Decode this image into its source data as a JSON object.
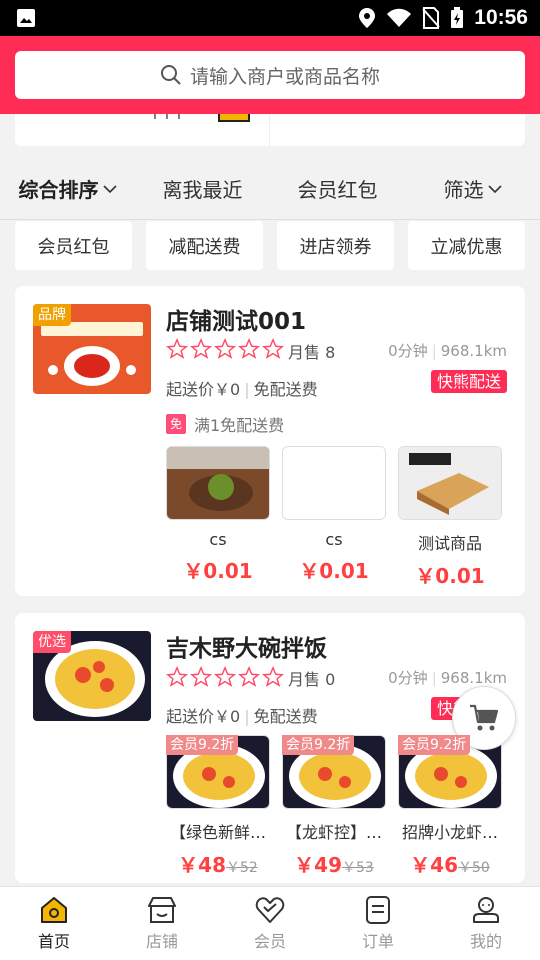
{
  "status_bar": {
    "time": "10:56"
  },
  "search": {
    "placeholder": "请输入商户或商品名称"
  },
  "sort_bar": {
    "items": [
      {
        "label": "综合排序",
        "active": true,
        "has_chevron": true
      },
      {
        "label": "离我最近",
        "active": false,
        "has_chevron": false
      },
      {
        "label": "会员红包",
        "active": false,
        "has_chevron": false
      },
      {
        "label": "筛选",
        "active": false,
        "has_chevron": true
      }
    ]
  },
  "chips": [
    "会员红包",
    "减配送费",
    "进店领券",
    "立减优惠"
  ],
  "shops": [
    {
      "tag": "品牌",
      "name": "店铺测试001",
      "rating_stars": 0,
      "monthly_sales": "月售 8",
      "time": "0分钟",
      "distance": "968.1km",
      "min_price": "起送价￥0",
      "delivery_fee": "免配送费",
      "delivery_badge": "快熊配送",
      "promo_icon": "免",
      "promo_text": "满1免配送费",
      "products": [
        {
          "name": "cs",
          "price": "￥0.01"
        },
        {
          "name": "cs",
          "price": "￥0.01"
        },
        {
          "name": "测试商品",
          "price": "￥0.01"
        }
      ]
    },
    {
      "tag": "优选",
      "name": "吉木野大碗拌饭",
      "rating_stars": 0,
      "monthly_sales": "月售 0",
      "time": "0分钟",
      "distance": "968.1km",
      "min_price": "起送价￥0",
      "delivery_fee": "免配送费",
      "delivery_badge": "快熊配送",
      "products": [
        {
          "vip_tag": "会员9.2折",
          "name": "【绿色新鲜…",
          "price": "￥48",
          "orig_price": "￥52"
        },
        {
          "vip_tag": "会员9.2折",
          "name": "【龙虾控】…",
          "price": "￥49",
          "orig_price": "￥53"
        },
        {
          "vip_tag": "会员9.2折",
          "name": "招牌小龙虾…",
          "price": "￥46",
          "orig_price": "￥50"
        }
      ]
    }
  ],
  "tabbar": [
    {
      "label": "首页",
      "icon": "home-icon",
      "active": true
    },
    {
      "label": "店铺",
      "icon": "store-icon",
      "active": false
    },
    {
      "label": "会员",
      "icon": "member-heart-icon",
      "active": false
    },
    {
      "label": "订单",
      "icon": "order-icon",
      "active": false
    },
    {
      "label": "我的",
      "icon": "profile-icon",
      "active": false
    }
  ],
  "colors": {
    "brand": "#ff2d55",
    "price": "#ff4040",
    "vip_tag": "#f08a8a"
  }
}
